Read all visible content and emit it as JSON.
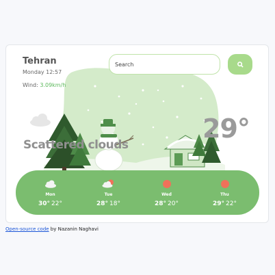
{
  "location": {
    "city": "Tehran",
    "datetime": "Monday 12:57",
    "wind_label": "Wind:",
    "wind_value": "3.09km/h"
  },
  "search": {
    "placeholder": "Search",
    "icon": "search-icon"
  },
  "current": {
    "temperature": "29°",
    "description": "Scattered clouds"
  },
  "forecast": [
    {
      "day": "Mon",
      "high": "30°",
      "low": "22°",
      "icon": "cloud-icon"
    },
    {
      "day": "Tue",
      "high": "28°",
      "low": "18°",
      "icon": "sun-cloud-icon"
    },
    {
      "day": "Wed",
      "high": "28°",
      "low": "20°",
      "icon": "sun-icon"
    },
    {
      "day": "Thu",
      "high": "29°",
      "low": "22°",
      "icon": "sun-icon"
    }
  ],
  "footer": {
    "link_text": "Open-source code",
    "credit": " by Nazanin Naghavi"
  },
  "colors": {
    "accent_green": "#7bbd6f",
    "search_button": "#a8da8b",
    "wind_value": "#5cb85c",
    "sun": "#f0715a"
  }
}
